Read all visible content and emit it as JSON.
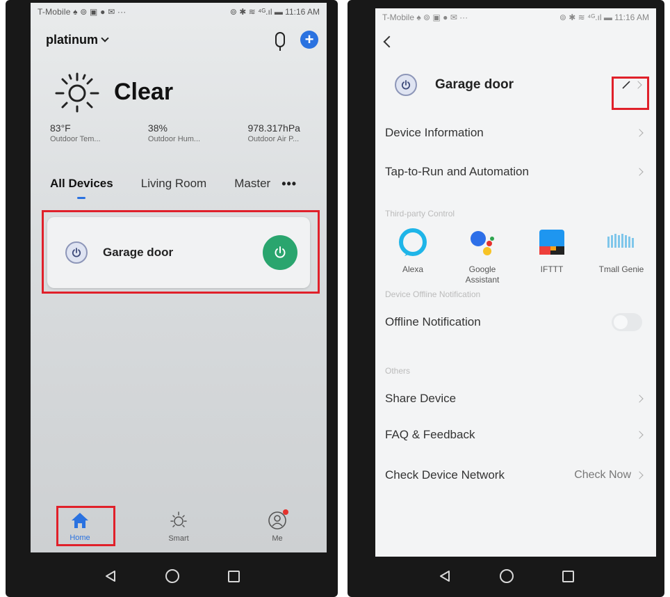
{
  "left_screen": {
    "status_bar": {
      "carrier": "T-Mobile ♠ ⊚ ▣ ● ✉ ···",
      "right": "⊚ ✱ ≋ ⁴ᴳ.ıl ▬ 11:16 AM"
    },
    "home_name": "platinum",
    "weather": {
      "condition": "Clear",
      "metrics": [
        {
          "value": "83°F",
          "label": "Outdoor Tem..."
        },
        {
          "value": "38%",
          "label": "Outdoor Hum..."
        },
        {
          "value": "978.317hPa",
          "label": "Outdoor Air P..."
        }
      ]
    },
    "rooms": [
      "All Devices",
      "Living Room",
      "Master"
    ],
    "more": "•••",
    "device": {
      "name": "Garage door",
      "power_color": "#2aa56e"
    },
    "bottom_nav": [
      {
        "label": "Home",
        "active": true
      },
      {
        "label": "Smart",
        "active": false
      },
      {
        "label": "Me",
        "active": false
      }
    ],
    "accent_color": "#2a72e0",
    "highlight_color": "#e0202a"
  },
  "right_screen": {
    "status_bar": {
      "carrier": "T-Mobile ♠ ⊚ ▣ ● ✉ ···",
      "right": "⊚ ✱ ≋ ⁴ᴳ.ıl ▬ 11:16 AM"
    },
    "device_name": "Garage door",
    "rows": {
      "device_information": "Device Information",
      "tap_to_run": "Tap-to-Run and Automation"
    },
    "sections": {
      "third_party": "Third-party Control",
      "offline": "Device Offline Notification",
      "others": "Others"
    },
    "third_party": [
      {
        "label": "Alexa",
        "icon": "alexa-icon"
      },
      {
        "label": "Google Assistant",
        "icon": "google-assistant-icon"
      },
      {
        "label": "IFTTT",
        "icon": "ifttt-icon"
      },
      {
        "label": "Tmall Genie",
        "icon": "tmall-genie-icon"
      }
    ],
    "offline_notification": {
      "label": "Offline Notification",
      "enabled": false
    },
    "others": {
      "share": "Share Device",
      "faq": "FAQ & Feedback",
      "network": "Check Device Network",
      "network_action": "Check Now"
    }
  }
}
